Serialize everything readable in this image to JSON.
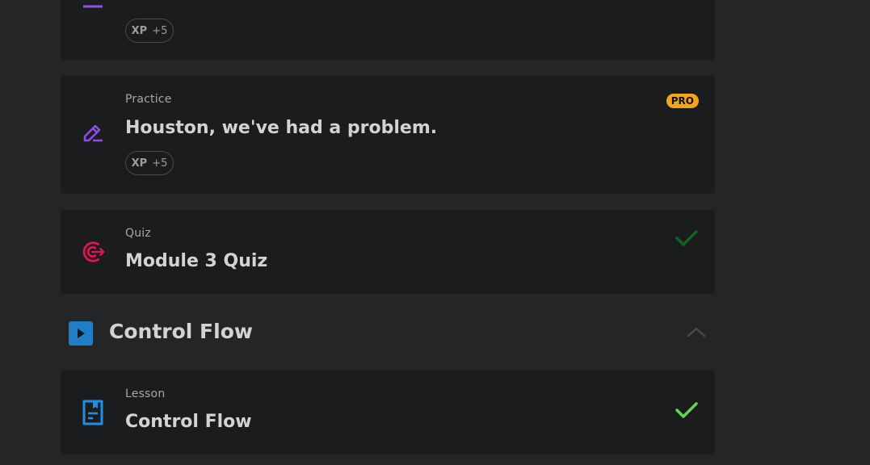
{
  "items": [
    {
      "kind": "",
      "title": "",
      "xp_label": "XP",
      "xp_value": "+5",
      "icon": "checklist-icon",
      "color": "#8d4ee8"
    },
    {
      "kind": "Practice",
      "title": "Houston, we've had a problem.",
      "xp_label": "XP",
      "xp_value": "+5",
      "badge": "PRO",
      "icon": "pencil-icon",
      "color": "#8d4ee8"
    },
    {
      "kind": "Quiz",
      "title": "Module 3 Quiz",
      "icon": "target-icon",
      "color": "#e0144f",
      "check_color": "#15611f"
    },
    {
      "kind": "Lesson",
      "title": "Control Flow",
      "icon": "document-icon",
      "color": "#1f8fe6",
      "check_color": "#5fd94e"
    }
  ],
  "section": {
    "title": "Control Flow",
    "icon": "play-icon",
    "icon_color": "#1f7fc5",
    "collapse_icon": "chevron-up-icon"
  }
}
